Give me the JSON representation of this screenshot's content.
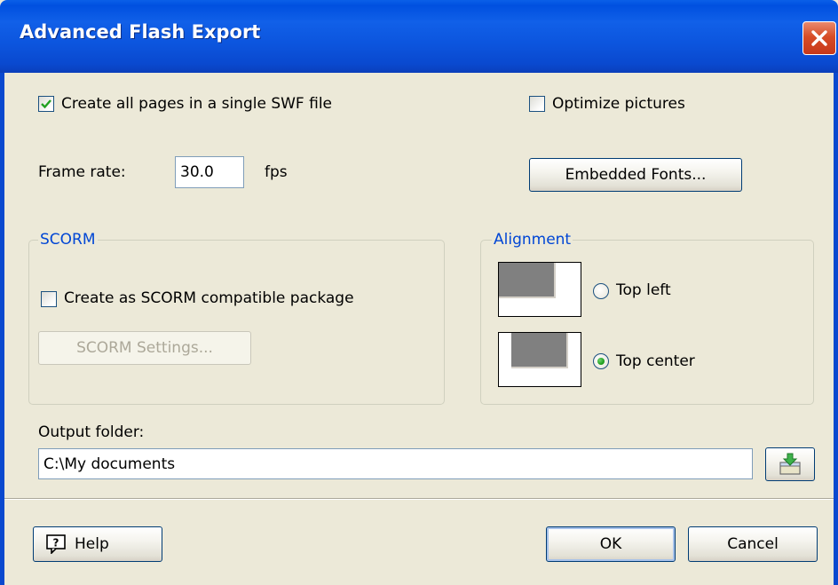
{
  "window": {
    "title": "Advanced Flash Export"
  },
  "options": {
    "single_swf_label": "Create all pages in a single SWF file",
    "single_swf_checked": true,
    "optimize_pictures_label": "Optimize pictures",
    "optimize_pictures_checked": false,
    "frame_rate_label": "Frame rate:",
    "frame_rate_value": "30.0",
    "frame_rate_unit": "fps",
    "embedded_fonts_button": "Embedded Fonts..."
  },
  "scorm": {
    "legend": "SCORM",
    "create_package_label": "Create as SCORM compatible package",
    "create_package_checked": false,
    "settings_button": "SCORM Settings..."
  },
  "alignment": {
    "legend": "Alignment",
    "top_left_label": "Top left",
    "top_center_label": "Top center",
    "selected": "Top center"
  },
  "output": {
    "label": "Output folder:",
    "path": "C:\\My documents",
    "browse_icon": "folder-download-icon"
  },
  "footer": {
    "help_button": "Help",
    "help_icon": "help-icon",
    "ok_button": "OK",
    "cancel_button": "Cancel"
  },
  "colors": {
    "titlebar": "#0a49cf",
    "dialog_bg": "#ece9d8",
    "group_legend": "#0046d5",
    "close_button": "#d74d27"
  }
}
